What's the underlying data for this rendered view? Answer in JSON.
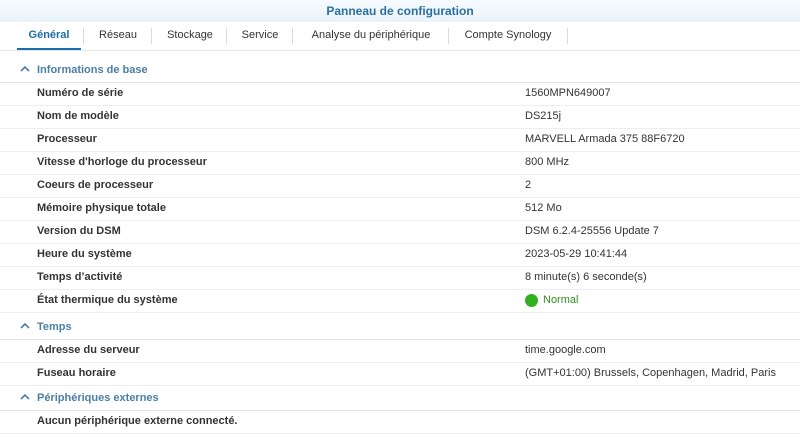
{
  "window": {
    "title": "Panneau de configuration"
  },
  "tabs": [
    {
      "label": "Général"
    },
    {
      "label": "Réseau"
    },
    {
      "label": "Stockage"
    },
    {
      "label": "Service"
    },
    {
      "label": "Analyse du périphérique"
    },
    {
      "label": "Compte Synology"
    }
  ],
  "sections": {
    "basic": {
      "title": "Informations de base",
      "rows": [
        {
          "key": "Numéro de série",
          "value": "1560MPN649007"
        },
        {
          "key": "Nom de modèle",
          "value": "DS215j"
        },
        {
          "key": "Processeur",
          "value": "MARVELL Armada 375 88F6720"
        },
        {
          "key": "Vitesse d'horloge du processeur",
          "value": "800 MHz"
        },
        {
          "key": "Coeurs de processeur",
          "value": "2"
        },
        {
          "key": "Mémoire physique totale",
          "value": "512 Mo"
        },
        {
          "key": "Version du DSM",
          "value": "DSM 6.2.4-25556 Update 7"
        },
        {
          "key": "Heure du système",
          "value": "2023-05-29 10:41:44"
        },
        {
          "key": "Temps d’activité",
          "value": "8 minute(s) 6 seconde(s)"
        },
        {
          "key": "État thermique du système",
          "value": "Normal"
        }
      ]
    },
    "time": {
      "title": "Temps",
      "rows": [
        {
          "key": "Adresse du serveur",
          "value": "time.google.com"
        },
        {
          "key": "Fuseau horaire",
          "value": "(GMT+01:00) Brussels, Copenhagen, Madrid, Paris"
        }
      ]
    },
    "external": {
      "title": "Périphériques externes",
      "rows": [
        {
          "key": "Aucun périphérique externe connecté."
        }
      ]
    }
  },
  "colors": {
    "accent": "#1b6ea8",
    "section": "#4a7fa6",
    "status_ok": "#31b01f"
  }
}
